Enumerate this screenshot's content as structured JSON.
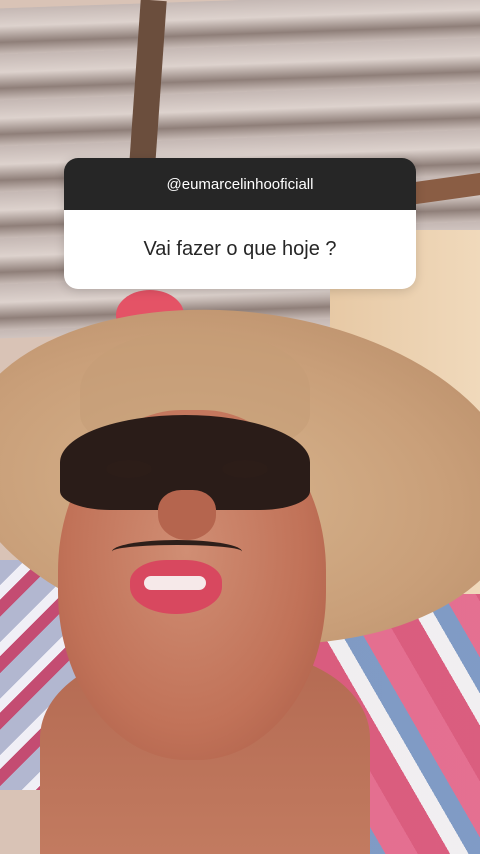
{
  "question_sticker": {
    "username": "@eumarcelinhooficiall",
    "question": "Vai fazer o que hoje ?"
  }
}
